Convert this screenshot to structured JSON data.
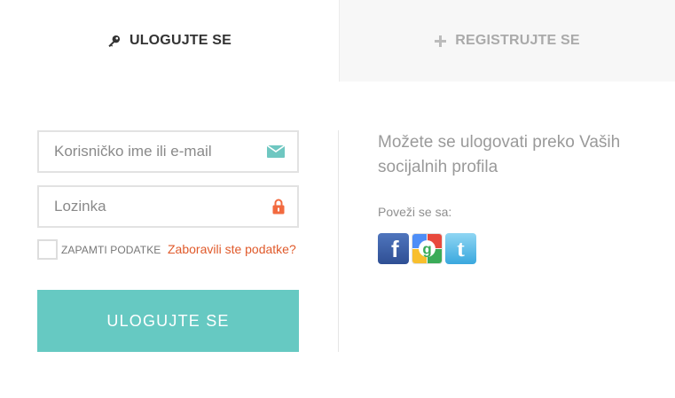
{
  "tabs": {
    "login": {
      "label": "ULOGUJTE SE",
      "icon": "key-icon"
    },
    "register": {
      "label": "REGISTRUJTE SE",
      "icon": "plus-icon"
    }
  },
  "form": {
    "username": {
      "placeholder": "Korisničko ime ili e-mail",
      "icon": "envelope-icon"
    },
    "password": {
      "placeholder": "Lozinka",
      "icon": "lock-icon"
    },
    "remember_label": "ZAPAMTI PODATKE",
    "forgot_label": "Zaboravili ste podatke?",
    "submit_label": "ULOGUJTE SE"
  },
  "social": {
    "heading": "Možete se ulogovati preko Vaših socijalnih profila",
    "connect_label": "Poveži se sa:",
    "networks": [
      {
        "name": "facebook",
        "icon": "facebook-icon"
      },
      {
        "name": "google",
        "icon": "google-icon"
      },
      {
        "name": "twitter",
        "icon": "twitter-icon"
      }
    ]
  },
  "colors": {
    "accent": "#66c9c2",
    "link": "#e05a2b",
    "lock": "#f26a3f",
    "envelope": "#6fc7c1"
  }
}
